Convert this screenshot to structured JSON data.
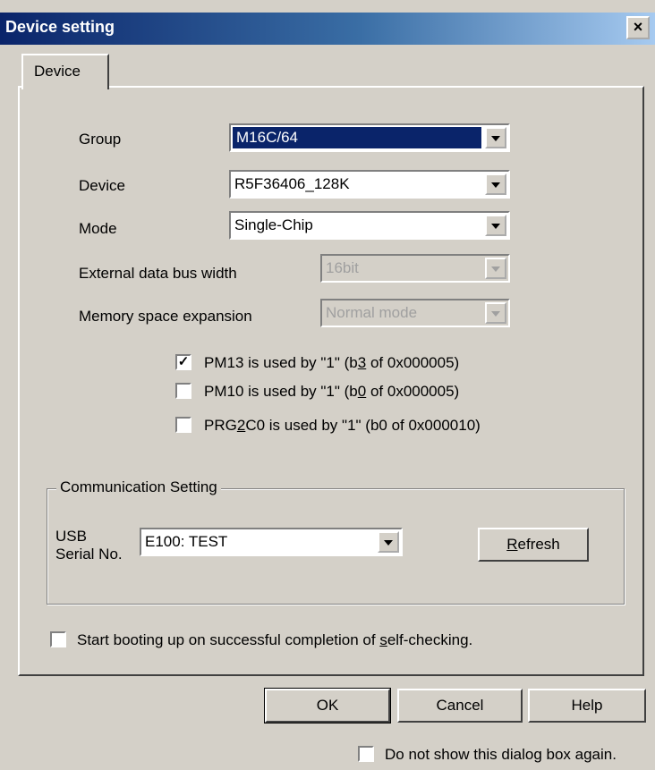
{
  "window": {
    "title": "Device setting",
    "close_glyph": "×"
  },
  "tabs": [
    {
      "label": "Device"
    }
  ],
  "form": {
    "group": {
      "label": "Group",
      "value": "M16C/64"
    },
    "device": {
      "label": "Device",
      "value": "R5F36406_128K"
    },
    "mode": {
      "label": "Mode",
      "value": "Single-Chip"
    },
    "ext_bus": {
      "label": "External data bus width",
      "value": "16bit"
    },
    "mem_exp": {
      "label": "Memory space expansion",
      "value": "Normal mode"
    },
    "pm13": {
      "checked": true,
      "label_a": "PM13 is used by \"1\" (b",
      "label_u": "3",
      "label_b": " of 0x000005)"
    },
    "pm10": {
      "checked": false,
      "label_a": "PM10 is used by \"1\" (b",
      "label_u": "0",
      "label_b": " of 0x000005)"
    },
    "prg2c0": {
      "checked": false,
      "label_a": "PRG",
      "label_u": "2",
      "label_b": "C0 is used by \"1\" (b0 of 0x000010)"
    }
  },
  "communication": {
    "legend": "Communication Setting",
    "usb_label_1": "USB",
    "usb_label_2": "Serial No.",
    "serial_value": "E100: TEST",
    "refresh_u": "R",
    "refresh_rest": "efresh"
  },
  "selfcheck": {
    "checked": false,
    "label_a": "Start booting up on successful completion of ",
    "label_u": "s",
    "label_b": "elf-checking."
  },
  "buttons": {
    "ok": "OK",
    "cancel": "Cancel",
    "help": "Help"
  },
  "dont_show": {
    "checked": false,
    "label": "Do not show this dialog box again."
  }
}
